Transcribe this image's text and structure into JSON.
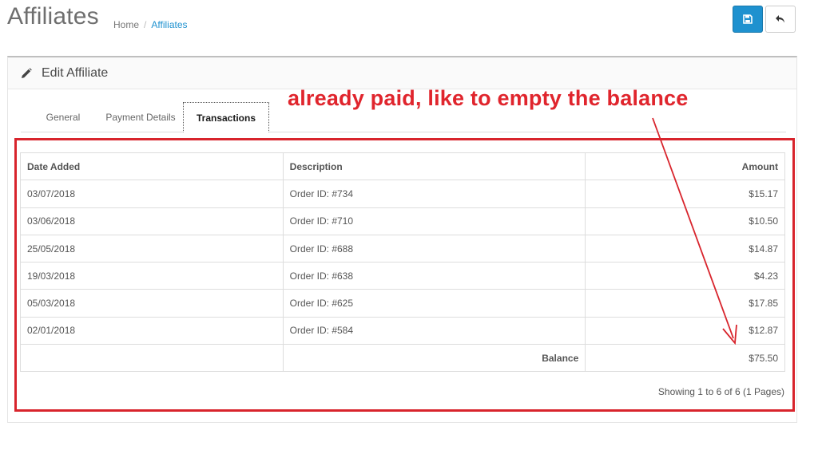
{
  "header": {
    "title": "Affiliates",
    "breadcrumb": [
      "Home",
      "Affiliates"
    ]
  },
  "panel": {
    "title": "Edit Affiliate"
  },
  "tabs": [
    {
      "label": "General",
      "active": false
    },
    {
      "label": "Payment Details",
      "active": false
    },
    {
      "label": "Transactions",
      "active": true
    }
  ],
  "table": {
    "columns": [
      "Date Added",
      "Description",
      "Amount"
    ],
    "rows": [
      {
        "date": "03/07/2018",
        "description": "Order ID: #734",
        "amount": "$15.17"
      },
      {
        "date": "03/06/2018",
        "description": "Order ID: #710",
        "amount": "$10.50"
      },
      {
        "date": "25/05/2018",
        "description": "Order ID: #688",
        "amount": "$14.87"
      },
      {
        "date": "19/03/2018",
        "description": "Order ID: #638",
        "amount": "$4.23"
      },
      {
        "date": "05/03/2018",
        "description": "Order ID: #625",
        "amount": "$17.85"
      },
      {
        "date": "02/01/2018",
        "description": "Order ID: #584",
        "amount": "$12.87"
      }
    ],
    "balance_label": "Balance",
    "balance_value": "$75.50"
  },
  "pagination_text": "Showing 1 to 6 of 6 (1 Pages)",
  "annotation": {
    "text": "already paid, like to empty the balance",
    "color": "#e0252d"
  },
  "icons": {
    "save": "save-icon",
    "back": "reply-icon",
    "edit": "pencil-icon"
  },
  "colors": {
    "primary": "#1e91cf",
    "annotation": "#d8242c"
  }
}
